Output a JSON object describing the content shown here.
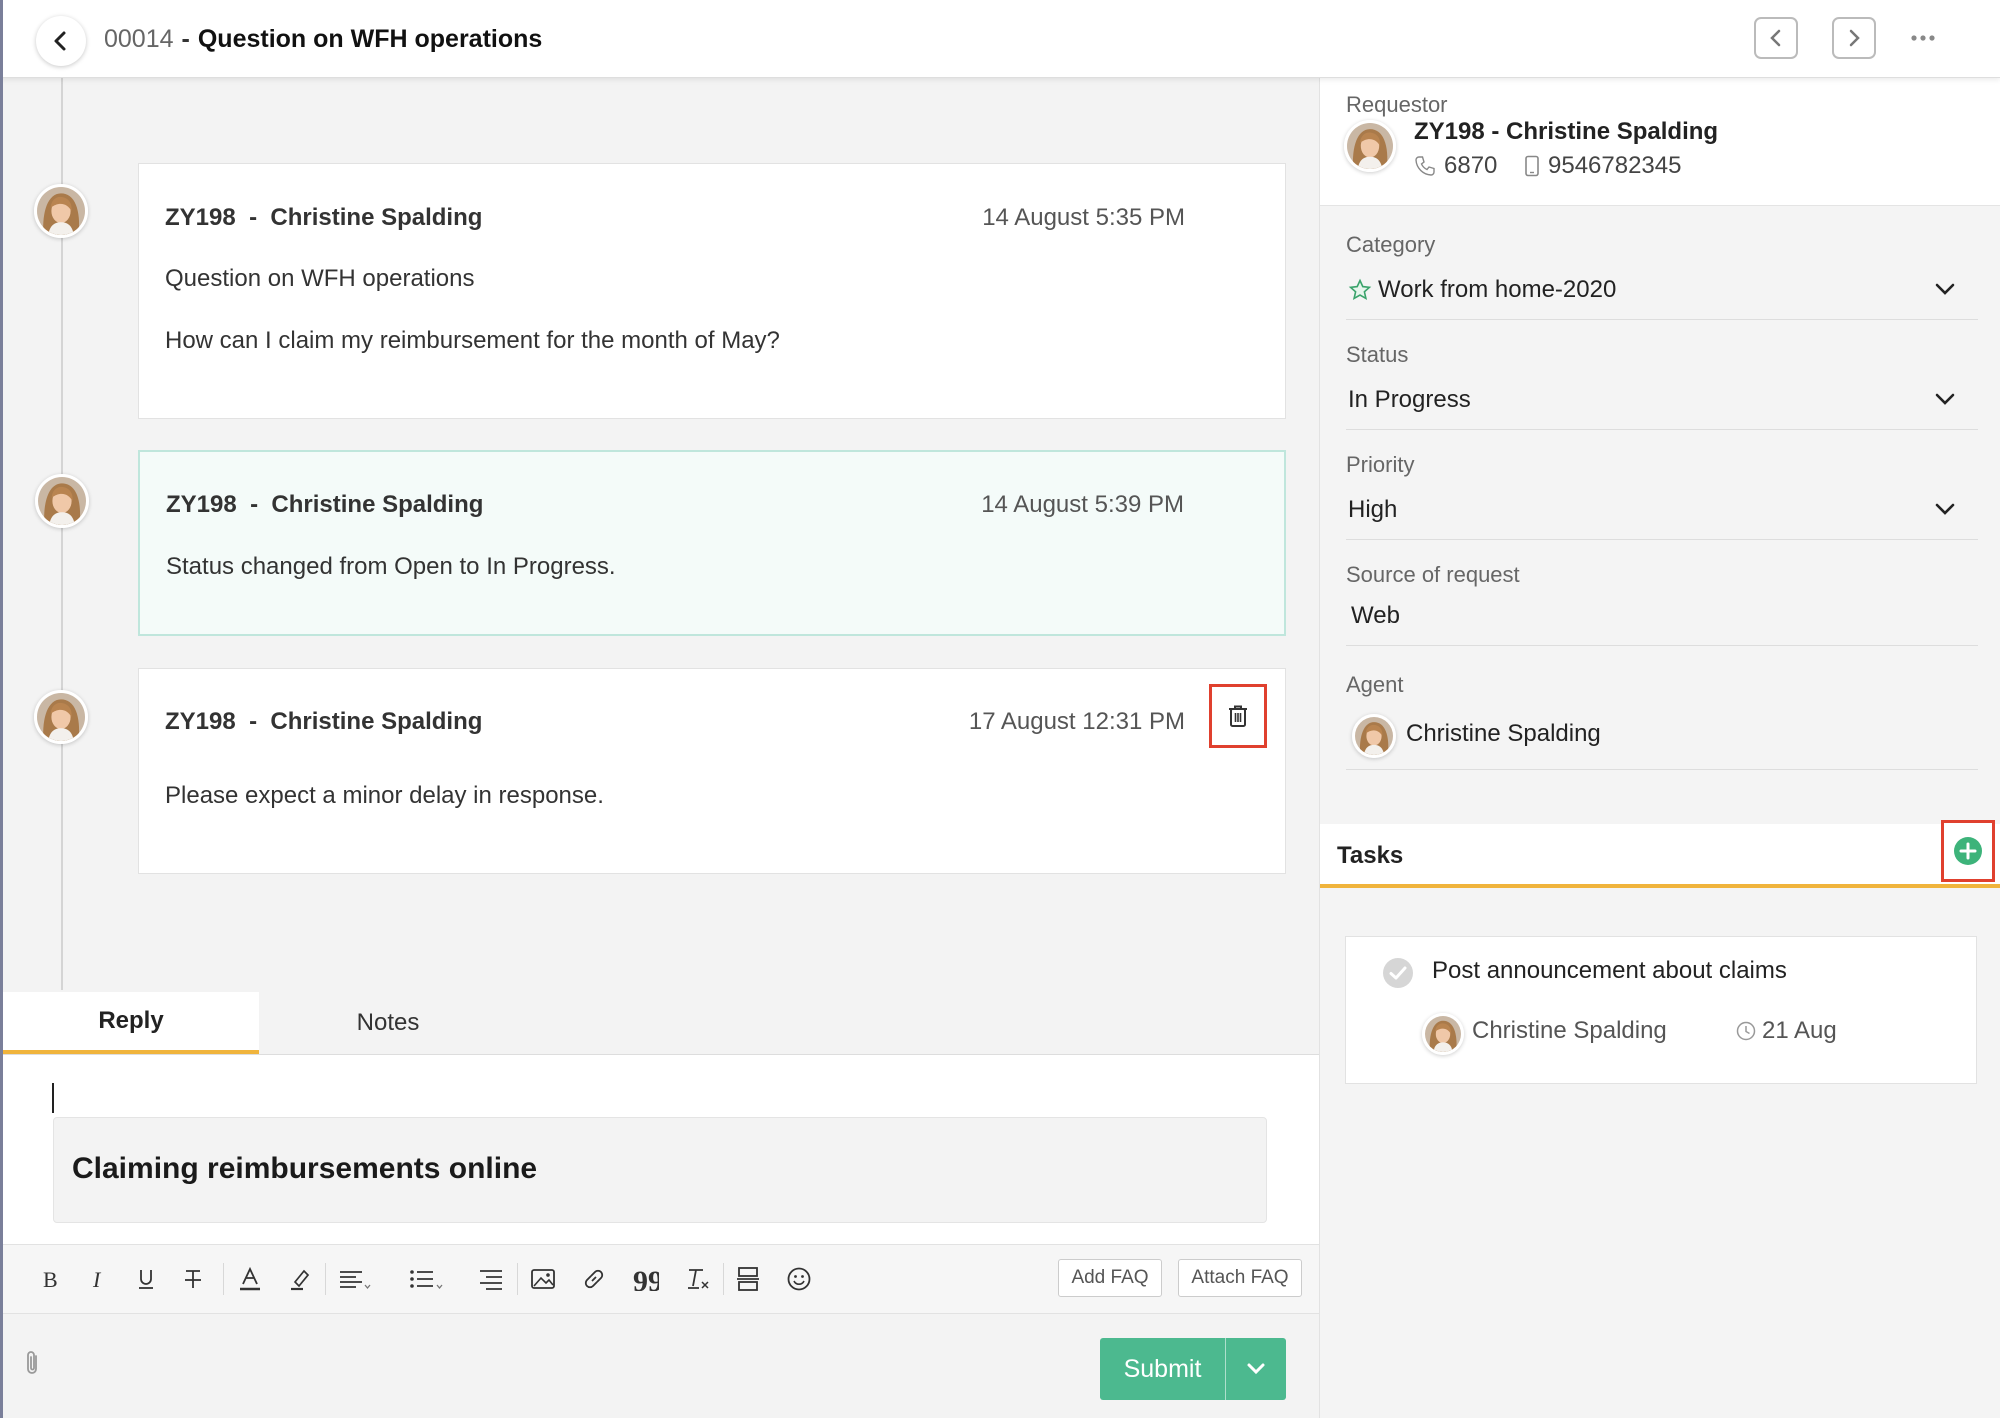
{
  "header": {
    "ticket_id": "00014",
    "separator": "-",
    "subject": "Question on WFH operations"
  },
  "icons": {
    "back": "chevron-left-icon",
    "prev": "chevron-left-icon",
    "next": "chevron-right-icon",
    "more": "ellipsis-icon",
    "delete": "trash-icon",
    "add_task": "plus-circle-icon",
    "attach": "paperclip-icon"
  },
  "conversation": [
    {
      "author_id": "ZY198",
      "separator": "-",
      "author_name": "Christine Spalding",
      "time": "14 August 5:35 PM",
      "subject": "Question on WFH operations",
      "body": "How can I claim my reimbursement for the month of May?"
    },
    {
      "author_id": "ZY198",
      "separator": "-",
      "author_name": "Christine Spalding",
      "time": "14 August 5:39 PM",
      "body": "Status changed from Open to In Progress."
    },
    {
      "author_id": "ZY198",
      "separator": "-",
      "author_name": "Christine Spalding",
      "time": "17 August 12:31 PM",
      "body": "Please expect a minor delay in response."
    }
  ],
  "reply": {
    "tabs": [
      "Reply",
      "Notes"
    ],
    "active_tab": "Reply",
    "faq_title": "Claiming reimbursements online",
    "add_faq_label": "Add FAQ",
    "attach_faq_label": "Attach FAQ",
    "submit_label": "Submit",
    "toolbar_tools": [
      "bold",
      "italic",
      "underline",
      "strikethrough",
      "font-color",
      "highlight",
      "align",
      "list",
      "indent",
      "image",
      "link",
      "quote",
      "clear-format",
      "insert-table",
      "emoji"
    ]
  },
  "sidebar": {
    "requestor_label": "Requestor",
    "requestor_name": "ZY198 - Christine Spalding",
    "requestor_ext": "6870",
    "requestor_mobile": "9546782345",
    "category_label": "Category",
    "category_value": "Work from home-2020",
    "status_label": "Status",
    "status_value": "In Progress",
    "priority_label": "Priority",
    "priority_value": "High",
    "source_label": "Source of request",
    "source_value": "Web",
    "agent_label": "Agent",
    "agent_value": "Christine Spalding",
    "tasks_label": "Tasks"
  },
  "tasks": [
    {
      "title": "Post announcement about claims",
      "assignee": "Christine Spalding",
      "due": "21 Aug"
    }
  ],
  "colors": {
    "accent": "#f0b43c",
    "submit": "#4cb98f",
    "highlight_box": "#e0402e",
    "status_card_border": "#bfe6dc"
  }
}
